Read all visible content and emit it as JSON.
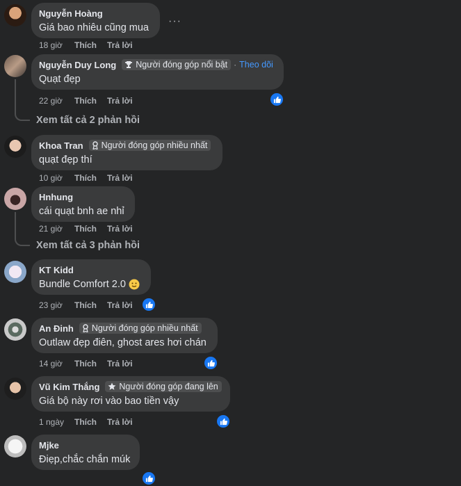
{
  "comments": [
    {
      "name": "Nguyễn Hoàng",
      "text": "Giá bao nhiêu cũng mua",
      "time": "18 giờ",
      "like": "Thích",
      "reply": "Trả lời",
      "more": "···"
    },
    {
      "name": "Nguyễn Duy Long",
      "badge": "Người đóng góp nổi bật",
      "follow": "Theo dõi",
      "text": "Quạt đẹp",
      "time": "22 giờ",
      "like": "Thích",
      "reply": "Trả lời",
      "see_replies": "Xem tất cả 2 phản hồi"
    },
    {
      "name": "Khoa Tran",
      "badge": "Người đóng góp nhiều nhất",
      "text": "quạt đẹp thí",
      "time": "10 giờ",
      "like": "Thích",
      "reply": "Trả lời"
    },
    {
      "name": "Hnhung",
      "text": "cái quạt bnh ae nhỉ",
      "time": "21 giờ",
      "like": "Thích",
      "reply": "Trả lời",
      "see_replies": "Xem tất cả 3 phản hồi"
    },
    {
      "name": "KT Kidd",
      "text": "Bundle Comfort 2.0",
      "time": "23 giờ",
      "like": "Thích",
      "reply": "Trả lời"
    },
    {
      "name": "An Đinh",
      "badge": "Người đóng góp nhiều nhất",
      "text": "Outlaw đẹp điên, ghost ares hơi chán",
      "time": "14 giờ",
      "like": "Thích",
      "reply": "Trả lời"
    },
    {
      "name": "Vũ Kim Thắng",
      "badge": "Người đóng góp đang lên",
      "text": "Giá bộ này rơi vào bao tiền vậy",
      "time": "1 ngày",
      "like": "Thích",
      "reply": "Trả lời"
    },
    {
      "name": "Mjke",
      "text": "Điẹp,chắc chắn múk"
    }
  ],
  "colors": {
    "background": "#242526",
    "bubble": "#3a3b3c",
    "accent": "#1877f2",
    "link": "#4599ff",
    "muted": "#b0b3b8"
  },
  "icons": {
    "reaction": "like-icon",
    "badge_top": "trophy-icon",
    "badge_most": "ribbon-icon",
    "badge_rising": "star-icon",
    "emoji": "smile-emoji-icon"
  }
}
